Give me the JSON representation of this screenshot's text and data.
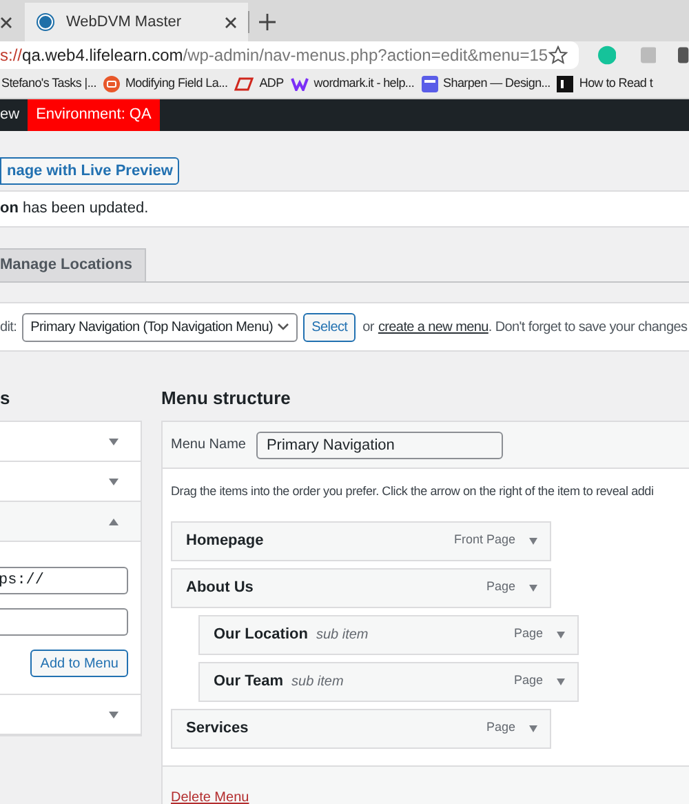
{
  "browser": {
    "tabs": [
      {
        "selected": false
      },
      {
        "title": "WebDVM Master",
        "selected": true
      }
    ],
    "address": {
      "scheme": "s://",
      "host": "qa.web4.lifelearn.com",
      "path": "/wp-admin/nav-menus.php?action=edit&menu=15"
    },
    "bookmarks": [
      {
        "label": "Stefano's Tasks |...",
        "kind": "none"
      },
      {
        "label": "Modifying Field La...",
        "kind": "orange"
      },
      {
        "label": "ADP",
        "kind": "adp"
      },
      {
        "label": "wordmark.it - help...",
        "kind": "purple"
      },
      {
        "label": "Sharpen — Design...",
        "kind": "blue"
      },
      {
        "label": "How to Read t",
        "kind": "lv"
      }
    ]
  },
  "admin_bar": {
    "items": [
      {
        "label": "ew",
        "kind": "plain"
      },
      {
        "label": "Environment: QA",
        "kind": "environment"
      }
    ]
  },
  "live_preview_button": "nage with Live Preview",
  "notice": "**on** has been updated.",
  "tabs": [
    {
      "label": "Manage Locations",
      "selected": false
    }
  ],
  "select_bar": {
    "label": "dit:",
    "menu_select": "Primary Navigation (Top Navigation Menu)",
    "button": "Select",
    "text_before": "or",
    "link": "create a new menu",
    "text_after": ". Don't forget to save your changes"
  },
  "left_column": {
    "heading": "s",
    "sections": [
      {
        "expanded": false
      },
      {
        "expanded": false
      },
      {
        "expanded": true,
        "url_value": "ps://",
        "button": "Add to Menu"
      },
      {
        "expanded": false
      }
    ]
  },
  "menu_structure": {
    "heading": "Menu structure",
    "name_label": "Menu Name",
    "name_value": "Primary Navigation",
    "instructions": "Drag the items into the order you prefer. Click the arrow on the right of the item to reveal addi",
    "items": [
      {
        "title": "Homepage",
        "type": "Front Page"
      },
      {
        "title": "About Us",
        "type": "Page",
        "children": [
          {
            "title": "Our Location",
            "note": "sub item",
            "type": "Page"
          },
          {
            "title": "Our Team",
            "note": "sub item",
            "type": "Page"
          }
        ]
      },
      {
        "title": "Services",
        "type": "Page"
      }
    ],
    "delete_link": "Delete Menu"
  }
}
